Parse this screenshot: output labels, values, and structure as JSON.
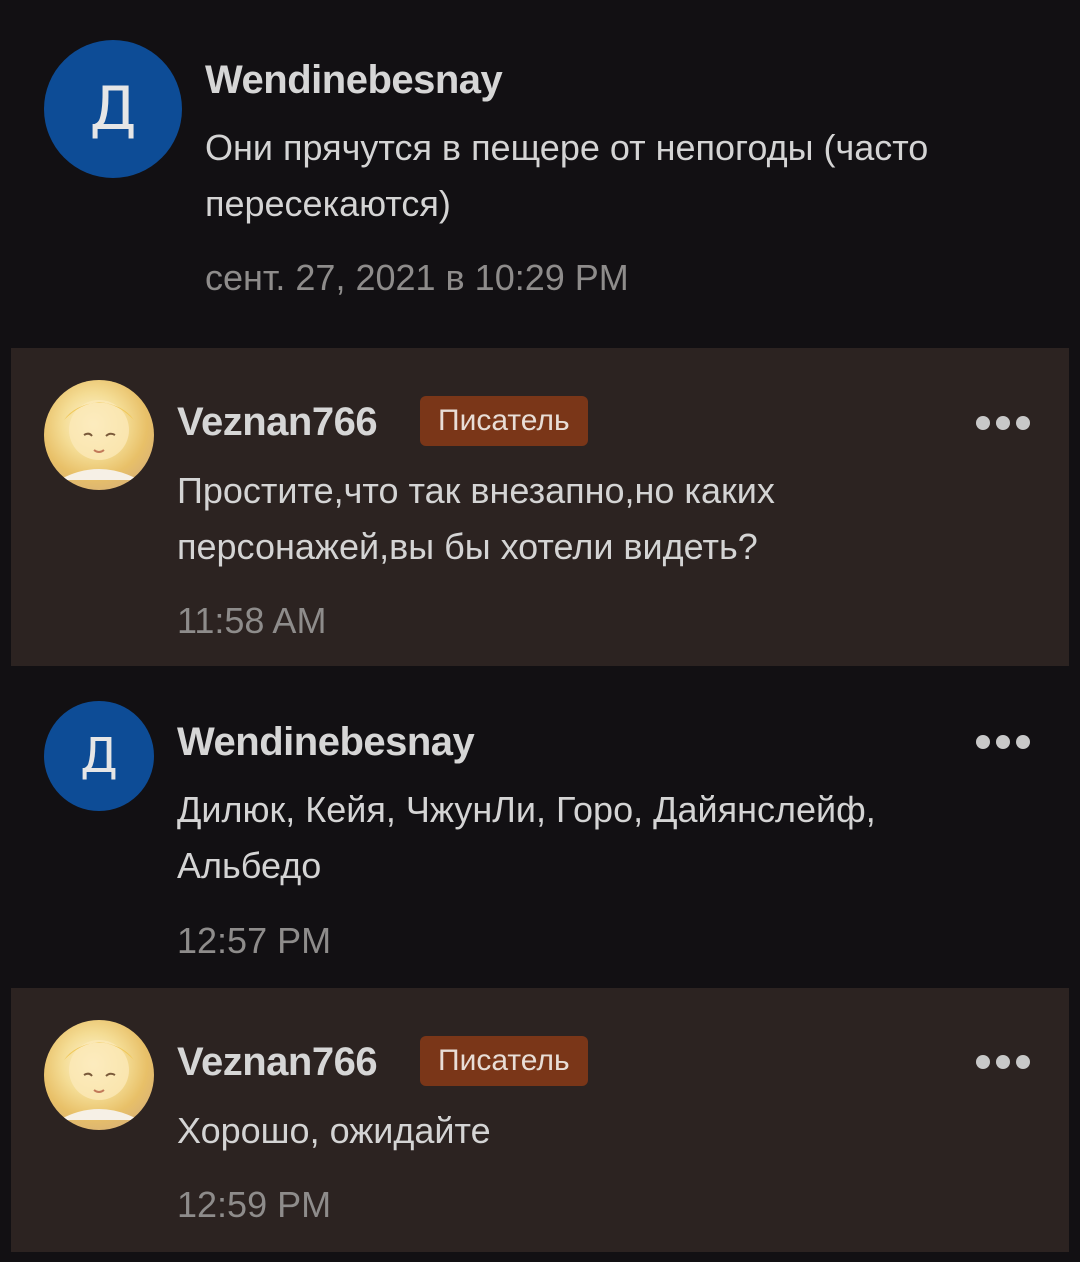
{
  "comments": [
    {
      "username": "Wendinebesnay",
      "avatar_letter": "Д",
      "text": "Они прячутся в пещере от непогоды (часто\nпересекаются)",
      "time": "сент. 27, 2021 в 10:29 PM"
    },
    {
      "username": "Veznan766",
      "badge": "Писатель",
      "avatar": "anime-character-avatar",
      "text": "Простите,что так внезапно,но каких\nперсонажей,вы бы хотели видеть?",
      "time": "11:58 AM"
    },
    {
      "username": "Wendinebesnay",
      "avatar_letter": "Д",
      "text": "Дилюк, Кейя, ЧжунЛи, Горо, Дайянслейф,\nАльбедо",
      "time": "12:57 PM"
    },
    {
      "username": "Veznan766",
      "badge": "Писатель",
      "avatar": "anime-character-avatar",
      "text": "Хорошо, ожидайте",
      "time": "12:59 PM"
    }
  ],
  "colors": {
    "background": "#121013",
    "highlight": "#2c2321",
    "badge": "#7a3618",
    "avatar_letter_bg": "#0d4c96"
  },
  "icons": {
    "more": "more-dots-icon"
  }
}
